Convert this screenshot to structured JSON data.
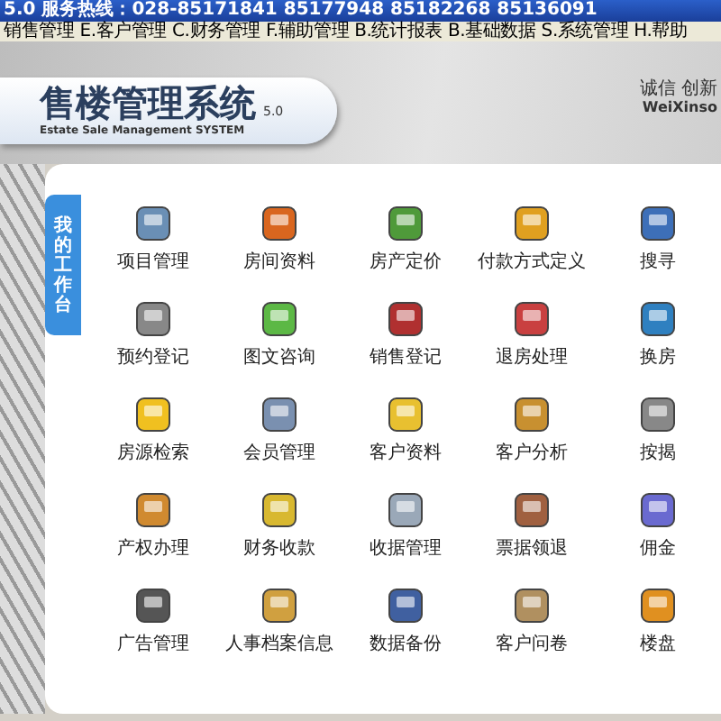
{
  "window": {
    "title": "5.0 服务热线：028-85171841 85177948 85182268 85136091"
  },
  "menu": [
    {
      "label": "销售管理"
    },
    {
      "label": "E.客户管理"
    },
    {
      "label": "C.财务管理"
    },
    {
      "label": "F.辅助管理"
    },
    {
      "label": "B.统计报表"
    },
    {
      "label": "B.基础数据"
    },
    {
      "label": "S.系统管理"
    },
    {
      "label": "H.帮助"
    }
  ],
  "header": {
    "logo_title": "售楼管理系统",
    "version": "5.0",
    "logo_subtitle": "Estate Sale Management SYSTEM",
    "slogan": "诚信 创新",
    "company": "WeiXinso"
  },
  "sidebar_tab": "我的工作台",
  "modules": [
    {
      "label": "项目管理"
    },
    {
      "label": "房间资料"
    },
    {
      "label": "房产定价"
    },
    {
      "label": "付款方式定义"
    },
    {
      "label": "搜寻"
    },
    {
      "label": "预约登记"
    },
    {
      "label": "图文咨询"
    },
    {
      "label": "销售登记"
    },
    {
      "label": "退房处理"
    },
    {
      "label": "换房"
    },
    {
      "label": "房源检索"
    },
    {
      "label": "会员管理"
    },
    {
      "label": "客户资料"
    },
    {
      "label": "客户分析"
    },
    {
      "label": "按揭"
    },
    {
      "label": "产权办理"
    },
    {
      "label": "财务收款"
    },
    {
      "label": "收据管理"
    },
    {
      "label": "票据领退"
    },
    {
      "label": "佣金"
    },
    {
      "label": "广告管理"
    },
    {
      "label": "人事档案信息"
    },
    {
      "label": "数据备份"
    },
    {
      "label": "客户问卷"
    },
    {
      "label": "楼盘"
    }
  ]
}
